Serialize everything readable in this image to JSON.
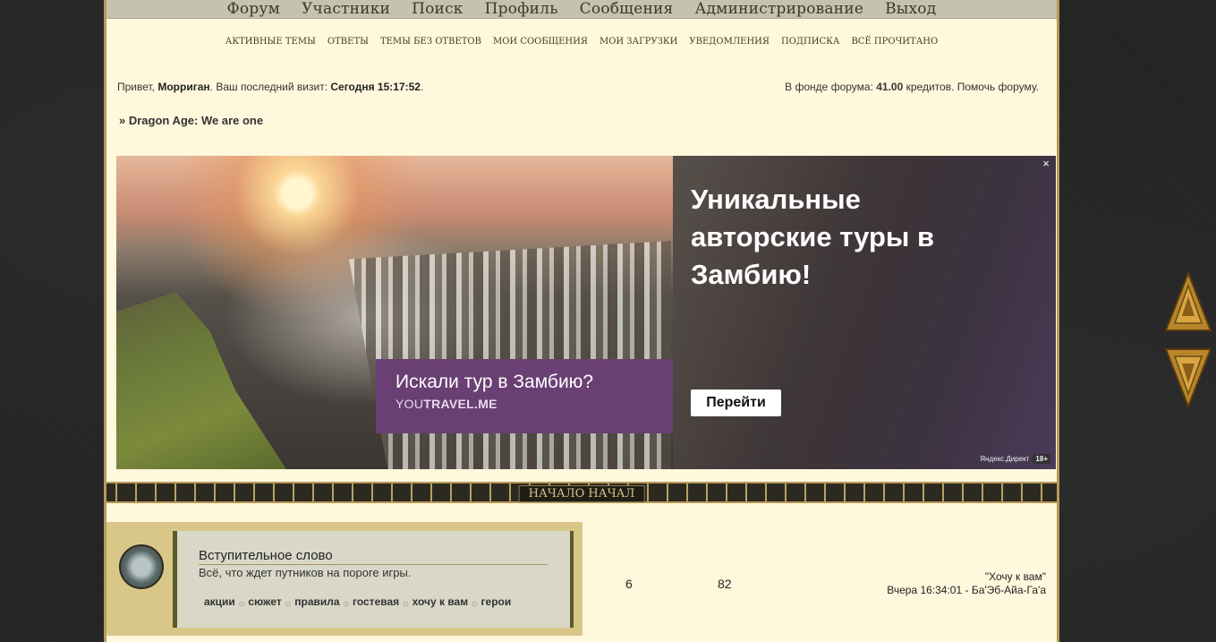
{
  "topnav": [
    "Форум",
    "Участники",
    "Поиск",
    "Профиль",
    "Сообщения",
    "Администрирование",
    "Выход"
  ],
  "subnav": [
    "Активные темы",
    "Ответы",
    "Темы без ответов",
    "Мои сообщения",
    "Мои загрузки",
    "Уведомления",
    "Подписка",
    "Всё прочитано"
  ],
  "welcome": {
    "greeting": "Привет, ",
    "username": "Морриган",
    "last_visit_label": ". Ваш последний визит: ",
    "last_visit": "Сегодня 15:17:52",
    "end": "."
  },
  "fund": {
    "label": "В фонде форума: ",
    "amount": "41.00",
    "unit": " кредитов. ",
    "help": "Помочь форуму."
  },
  "breadcrumb": "» Dragon Age: We are one",
  "ad": {
    "headline": "Уникальные авторские туры в Замбию!",
    "box_title": "Искали тур в Замбию?",
    "box_url_a": "YOU",
    "box_url_b": "TRAVEL.ME",
    "button": "Перейти",
    "close": "×",
    "direct": "Яндекс.Директ",
    "age": "18+"
  },
  "category": {
    "title": "НАЧАЛО НАЧАЛ"
  },
  "forum": {
    "name": "Вступительное слово",
    "description": "Всё, что ждет путников на пороге игры.",
    "links": [
      "акции",
      "сюжет",
      "правила",
      "гостевая",
      "хочу к вам",
      "герои"
    ],
    "separator": "۞",
    "topics": "6",
    "posts": "82",
    "last_topic": "\"Хочу к вам\"",
    "last_time": "Вчера 16:34:01 - Ба'Эб-Айа-Га'а"
  },
  "colors": {
    "page_bg": "#fff8dc",
    "accent": "#b69a5b",
    "dark_bg": "#262626"
  }
}
